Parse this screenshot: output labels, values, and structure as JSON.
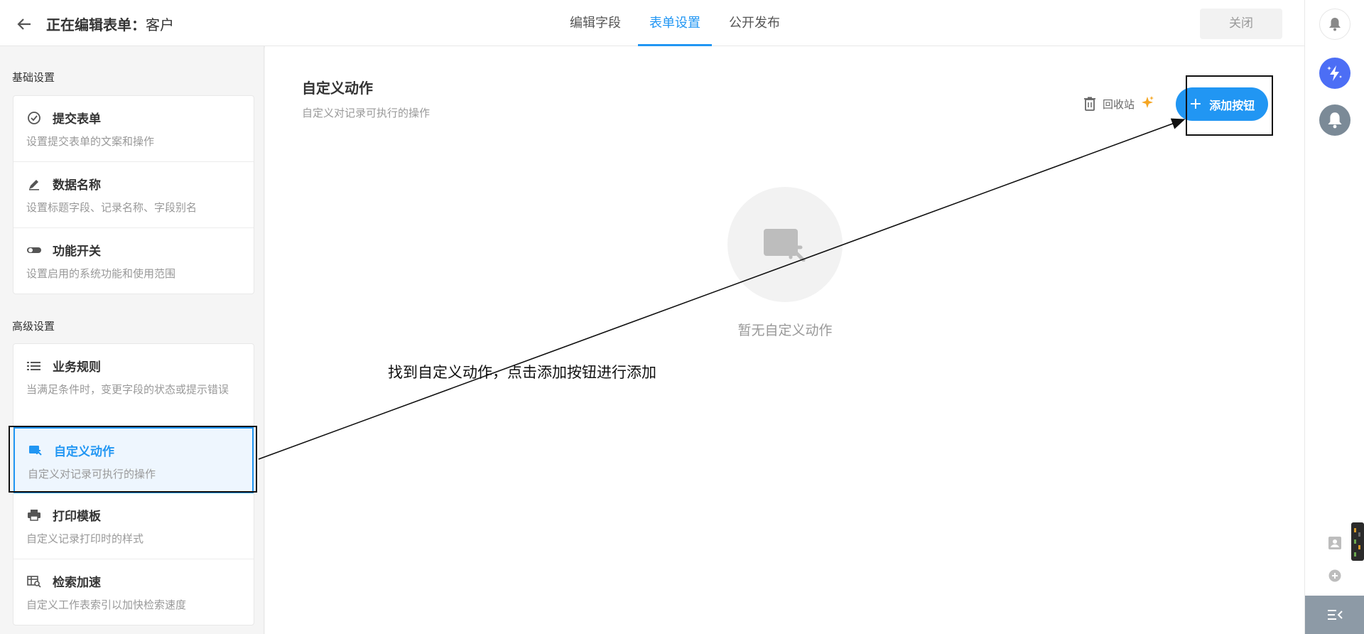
{
  "header": {
    "title_prefix": "正在编辑表单：",
    "form_name": "客户",
    "tabs": [
      {
        "label": "编辑字段"
      },
      {
        "label": "表单设置"
      },
      {
        "label": "公开发布"
      }
    ],
    "active_tab": "表单设置",
    "close_label": "关闭"
  },
  "sidebar": {
    "basic_title": "基础设置",
    "basic_items": [
      {
        "icon": "check-circle-icon",
        "title": "提交表单",
        "desc": "设置提交表单的文案和操作"
      },
      {
        "icon": "pen-icon",
        "title": "数据名称",
        "desc": "设置标题字段、记录名称、字段别名"
      },
      {
        "icon": "toggle-icon",
        "title": "功能开关",
        "desc": "设置启用的系统功能和使用范围"
      }
    ],
    "advanced_title": "高级设置",
    "advanced_items": [
      {
        "icon": "list-icon",
        "title": "业务规则",
        "desc": "当满足条件时，变更字段的状态或提示错误"
      },
      {
        "icon": "cursor-window-icon",
        "title": "自定义动作",
        "desc": "自定义对记录可执行的操作",
        "active": true
      },
      {
        "icon": "printer-icon",
        "title": "打印模板",
        "desc": "自定义记录打印时的样式"
      },
      {
        "icon": "search-table-icon",
        "title": "检索加速",
        "desc": "自定义工作表索引以加快检索速度"
      }
    ]
  },
  "main": {
    "title": "自定义动作",
    "subtitle": "自定义对记录可执行的操作",
    "recycle_label": "回收站",
    "add_button_label": "添加按钮",
    "add_button_plus": "+",
    "empty_text": "暂无自定义动作"
  },
  "annotation": {
    "text": "找到自定义动作，点击添加按钮进行添加"
  },
  "colors": {
    "accent": "#2196f3",
    "ai_button": "#4c6ef5",
    "bell_dark": "#7b8a97"
  }
}
